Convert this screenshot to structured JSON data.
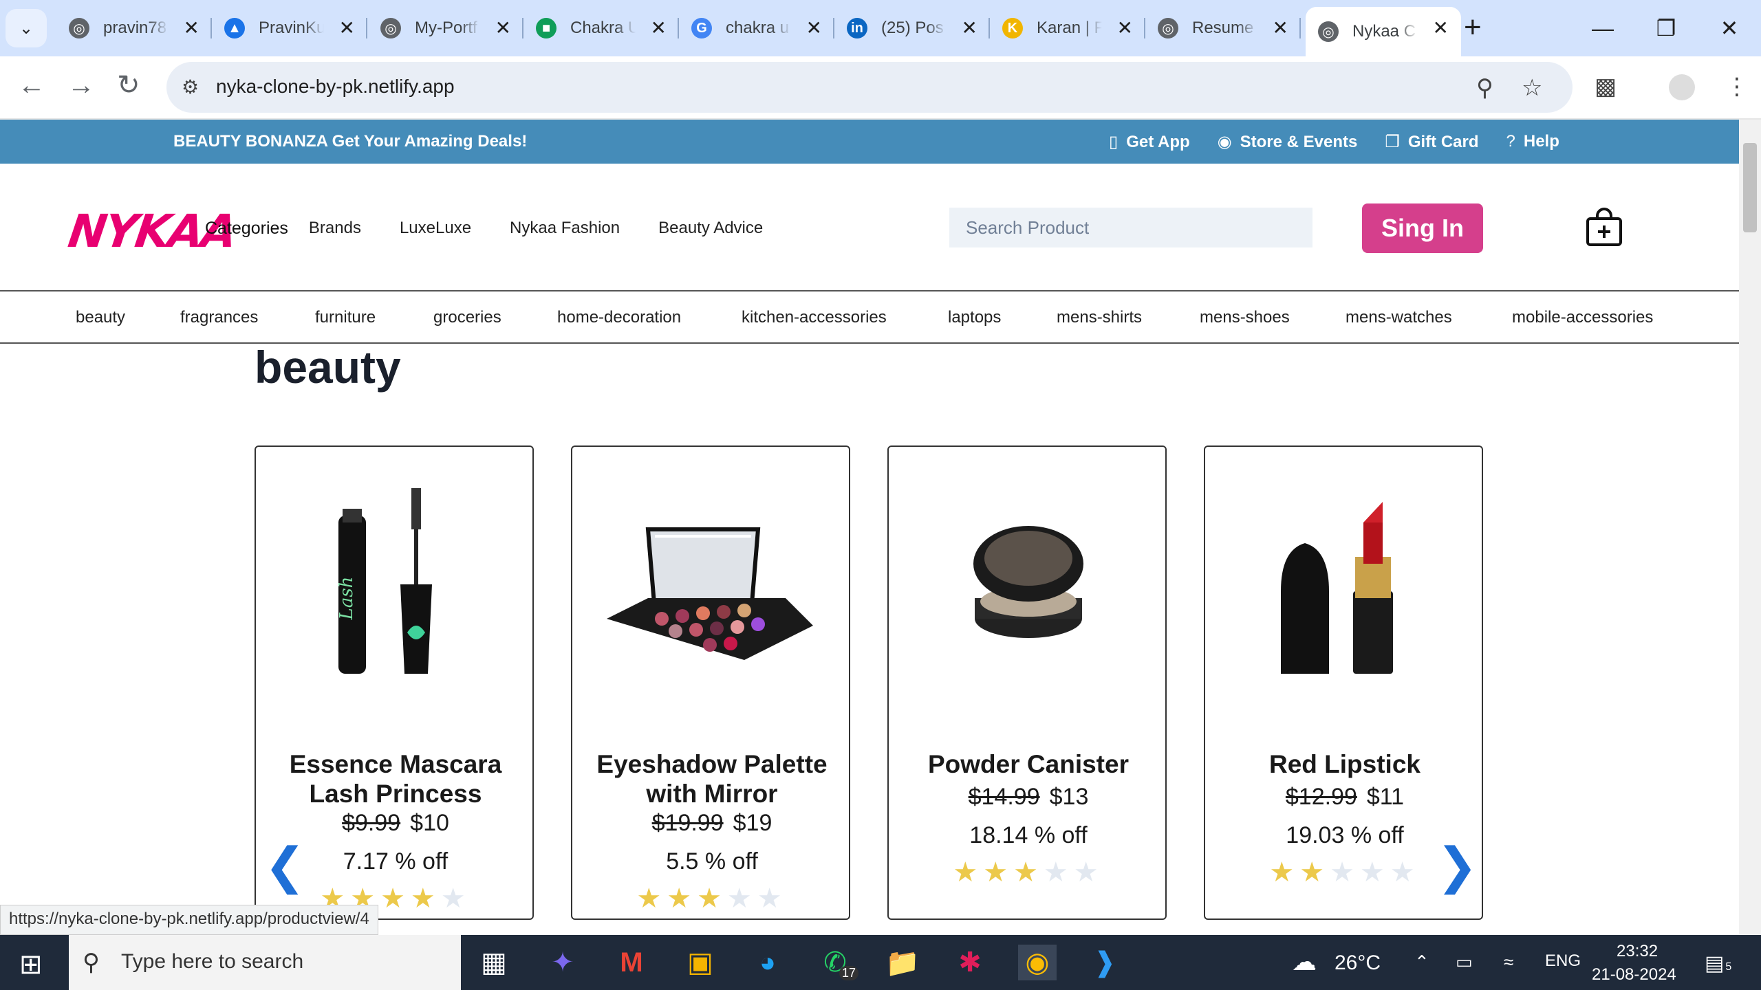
{
  "browser": {
    "tabs": [
      {
        "title": "pravin78",
        "icon": "globe-icon",
        "color": "#5f6368"
      },
      {
        "title": "PravinKu",
        "icon": "google-drive-icon",
        "color": "#1a73e8"
      },
      {
        "title": "My-Portf",
        "icon": "globe-icon",
        "color": "#5f6368"
      },
      {
        "title": "Chakra U",
        "icon": "chakra-icon",
        "color": "#0f9d58"
      },
      {
        "title": "chakra u",
        "icon": "google-icon",
        "color": "#4285f4"
      },
      {
        "title": "(25) Pos",
        "icon": "linkedin-icon",
        "color": "#0a66c2"
      },
      {
        "title": "Karan | F",
        "icon": "k-icon",
        "color": "#f1b500"
      },
      {
        "title": "Resume",
        "icon": "globe-icon",
        "color": "#5f6368"
      },
      {
        "title": "Nykaa C",
        "icon": "globe-icon",
        "color": "#5f6368"
      }
    ],
    "url": "nyka-clone-by-pk.netlify.app",
    "status_url": "https://nyka-clone-by-pk.netlify.app/productview/4"
  },
  "promo": {
    "text": "BEAUTY BONANZA Get Your Amazing Deals!",
    "links": [
      {
        "label": "Get App",
        "icon": "phone-icon"
      },
      {
        "label": "Store & Events",
        "icon": "location-icon"
      },
      {
        "label": "Gift Card",
        "icon": "gift-icon"
      },
      {
        "label": "Help",
        "icon": "help-icon"
      }
    ]
  },
  "header": {
    "logo": "NYKAA",
    "nav": [
      "Categories",
      "Brands",
      "LuxeLuxe",
      "Nykaa Fashion",
      "Beauty Advice"
    ],
    "search_placeholder": "Search Product",
    "signin_label": "Sing In"
  },
  "categories": [
    "beauty",
    "fragrances",
    "furniture",
    "groceries",
    "home-decoration",
    "kitchen-accessories",
    "laptops",
    "mens-shirts",
    "mens-shoes",
    "mens-watches",
    "mobile-accessories"
  ],
  "section_title": "beauty",
  "products": [
    {
      "name": "Essence Mascara Lash Princess",
      "old_price": "$9.99",
      "price": "$10",
      "discount": "7.17 % off",
      "rating": 4
    },
    {
      "name": "Eyeshadow Palette with Mirror",
      "old_price": "$19.99",
      "price": "$19",
      "discount": "5.5 % off",
      "rating": 3
    },
    {
      "name": "Powder Canister",
      "old_price": "$14.99",
      "price": "$13",
      "discount": "18.14 % off",
      "rating": 3
    },
    {
      "name": "Red Lipstick",
      "old_price": "$12.99",
      "price": "$11",
      "discount": "19.03 % off",
      "rating": 2
    }
  ],
  "taskbar": {
    "search_placeholder": "Type here to search",
    "whatsapp_badge": "17",
    "weather": "26°C",
    "lang": "ENG",
    "time": "23:32",
    "date": "21-08-2024",
    "notif_count": "5"
  },
  "colors": {
    "promo": "#458cb9",
    "brand": "#e80071",
    "signin": "#d53f8c",
    "star": "#ecc94b"
  }
}
